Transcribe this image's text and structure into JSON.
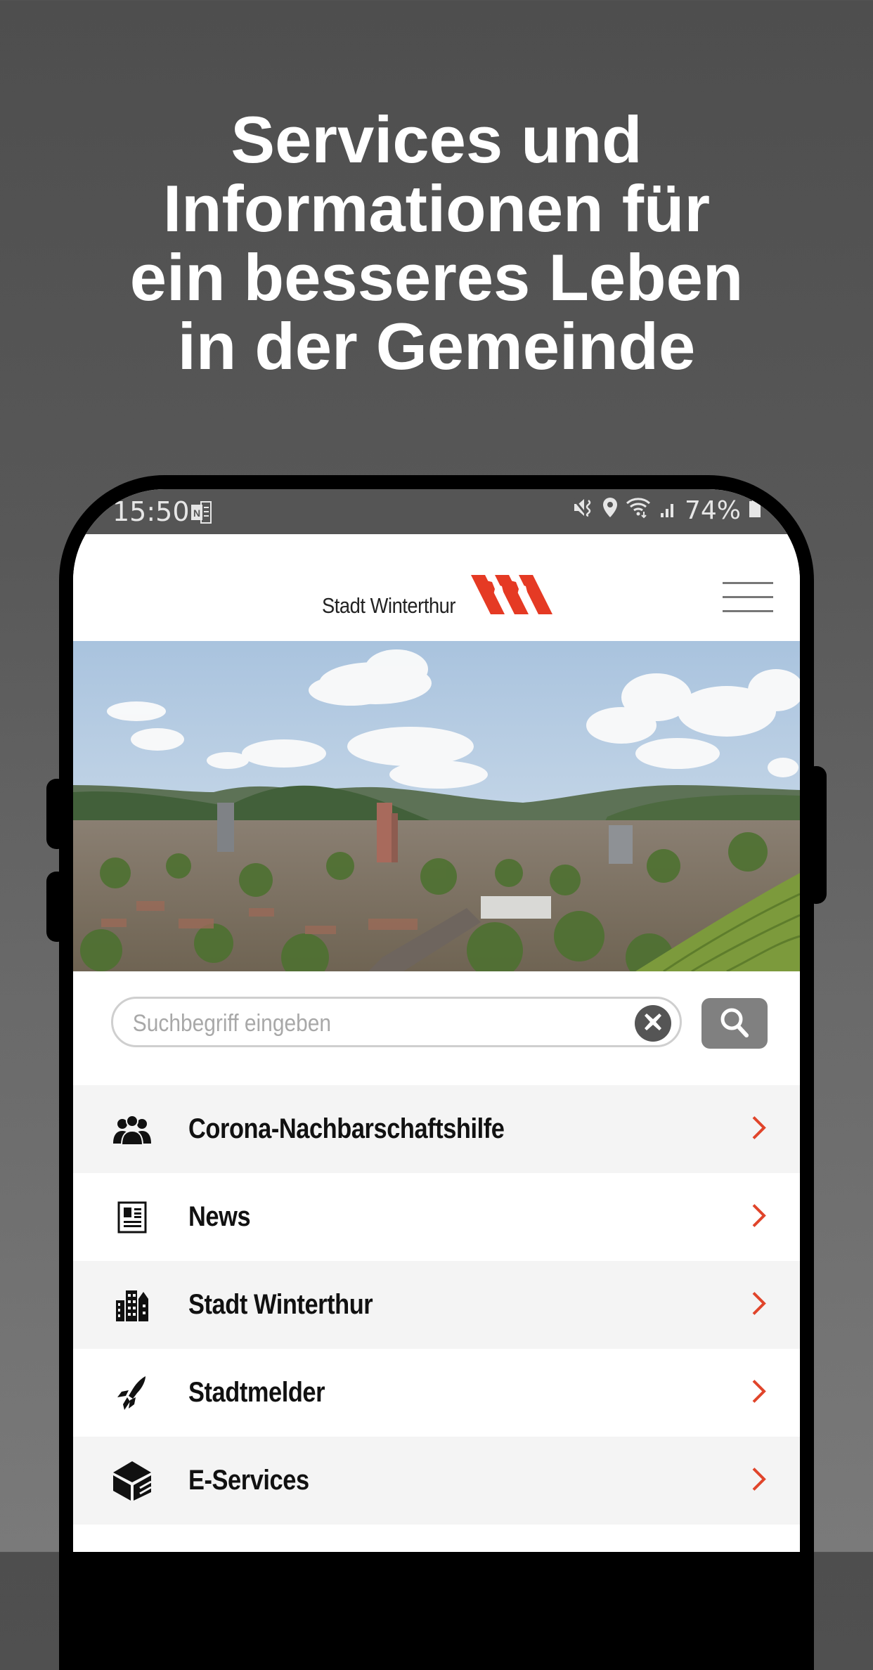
{
  "headline": {
    "lines": [
      "Services und",
      "Informationen für",
      "ein besseres Leben",
      "in der Gemeinde"
    ]
  },
  "statusbar": {
    "time": "15:50",
    "left_icons": [
      "onenote-notification-icon"
    ],
    "right_icons": [
      "vibrate-mute-icon",
      "location-icon",
      "wifi-icon",
      "signal-icon"
    ],
    "battery_percent": "74%"
  },
  "appbar": {
    "logo_text": "Stadt Winterthur",
    "brand_color": "#e53a24",
    "menu_icon": "hamburger-icon"
  },
  "hero": {
    "description": "Panorama of Winterthur city with hills and clouds"
  },
  "search": {
    "placeholder": "Suchbegriff eingeben",
    "value": "",
    "clear_icon": "clear-x-icon",
    "search_icon": "magnifier-icon"
  },
  "menu": {
    "chevron_color": "#e0442a",
    "items": [
      {
        "label": "Corona-Nachbarschaftshilfe",
        "icon": "people-group-icon"
      },
      {
        "label": "News",
        "icon": "newspaper-icon"
      },
      {
        "label": "Stadt Winterthur",
        "icon": "city-buildings-icon"
      },
      {
        "label": "Stadtmelder",
        "icon": "rocket-icon"
      },
      {
        "label": "E-Services",
        "icon": "cube-e-icon"
      }
    ]
  }
}
